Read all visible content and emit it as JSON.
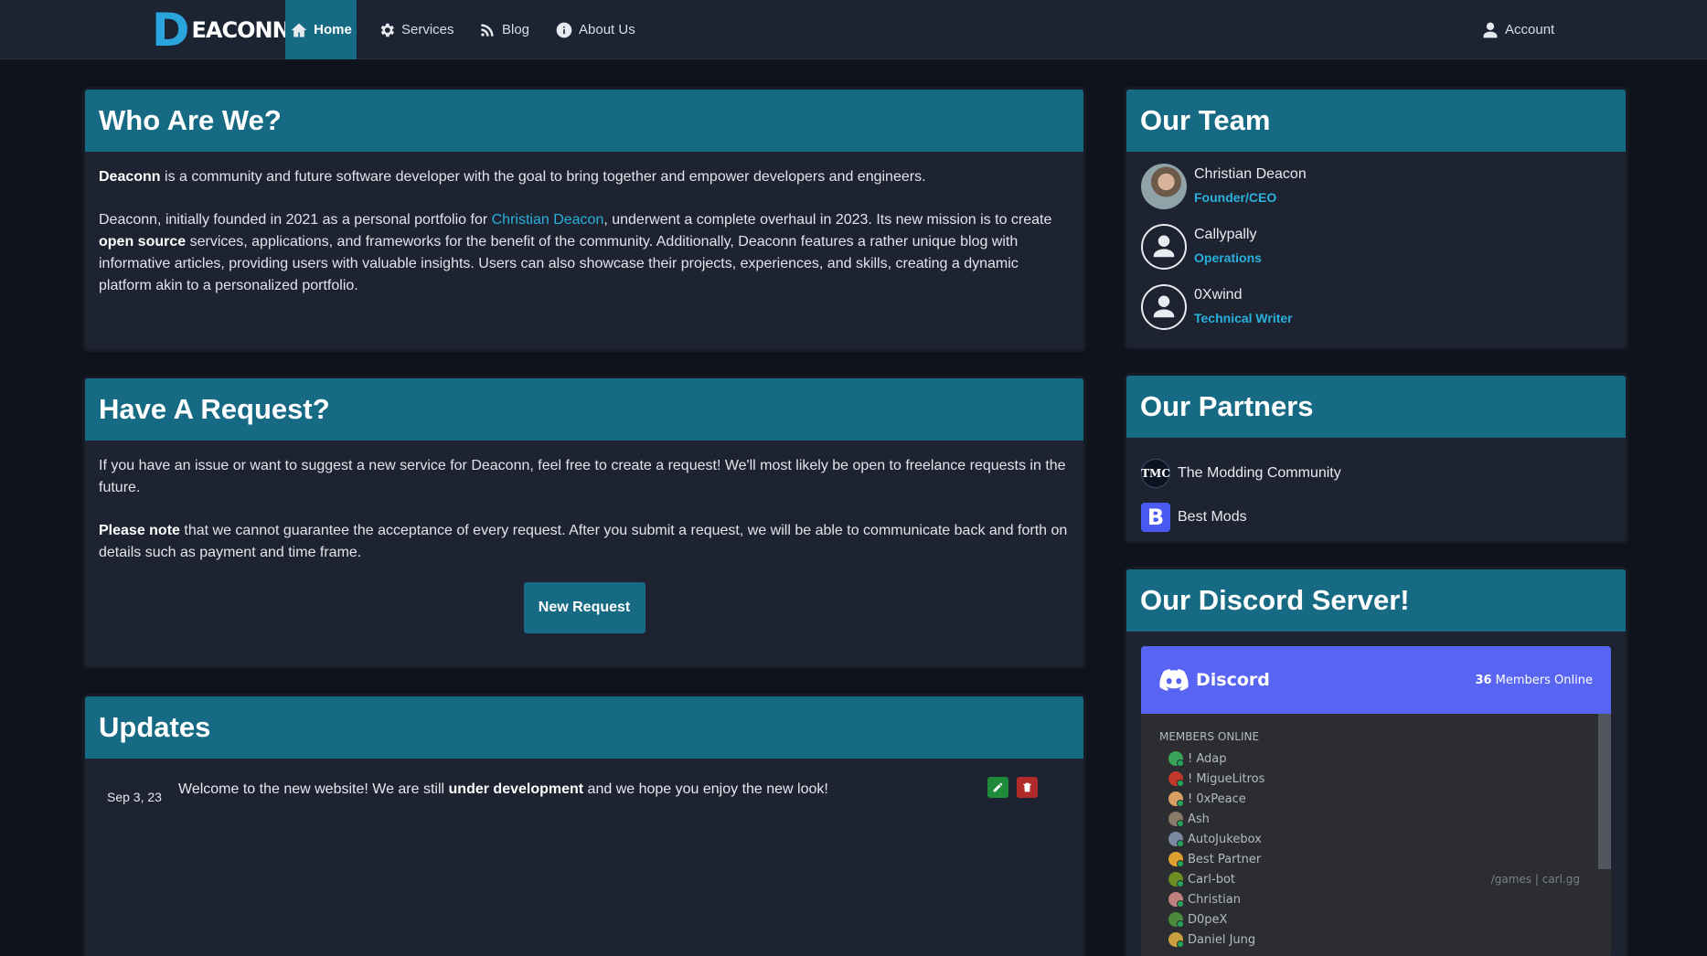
{
  "brand": {
    "letter": "D",
    "rest": "EACONN"
  },
  "nav": {
    "home": "Home",
    "services": "Services",
    "blog": "Blog",
    "about": "About Us",
    "account": "Account"
  },
  "who": {
    "title": "Who Are We?",
    "p1_bold": "Deaconn",
    "p1_rest": " is a community and future software developer with the goal to bring together and empower developers and engineers.",
    "p2_a": "Deaconn, initially founded in 2021 as a personal portfolio for ",
    "p2_link": "Christian Deacon",
    "p2_b": ", underwent a complete overhaul in 2023. Its new mission is to create ",
    "p2_bold": "open source",
    "p2_c": " services, applications, and frameworks for the benefit of the community. Additionally, Deaconn features a rather unique blog with informative articles, providing users with valuable insights. Users can also showcase their projects, experiences, and skills, creating a dynamic platform akin to a personalized portfolio."
  },
  "request": {
    "title": "Have A Request?",
    "p1": "If you have an issue or want to suggest a new service for Deaconn, feel free to create a request! We'll most likely be open to freelance requests in the future.",
    "p2_bold": "Please note",
    "p2_rest": " that we cannot guarantee the acceptance of every request. After you submit a request, we will be able to communicate back and forth on details such as payment and time frame.",
    "button": "New Request"
  },
  "updates": {
    "title": "Updates",
    "items": [
      {
        "date": "Sep 3, 23",
        "text_a": "Welcome to the new website! We are still ",
        "text_bold": "under development",
        "text_b": " and we hope you enjoy the new look!"
      }
    ]
  },
  "team": {
    "title": "Our Team",
    "members": [
      {
        "name": "Christian Deacon",
        "role": "Founder/CEO"
      },
      {
        "name": "Callypally",
        "role": "Operations"
      },
      {
        "name": "0Xwind",
        "role": "Technical Writer"
      }
    ]
  },
  "partners": {
    "title": "Our Partners",
    "items": [
      {
        "name": "The Modding Community",
        "logo_text": "TMC"
      },
      {
        "name": "Best Mods",
        "logo_text": "B"
      }
    ]
  },
  "discord": {
    "title": "Our Discord Server!",
    "brand": "Discord",
    "online_count": "36",
    "online_label": " Members Online",
    "section": "MEMBERS ONLINE",
    "members": [
      {
        "name": "! Adap",
        "color": "#3aa35a",
        "game": ""
      },
      {
        "name": "! MigueLitros",
        "color": "#c0392b",
        "game": ""
      },
      {
        "name": "! 0xPeace",
        "color": "#d9a066",
        "game": ""
      },
      {
        "name": "Ash",
        "color": "#8a7a6a",
        "game": ""
      },
      {
        "name": "AutoJukebox",
        "color": "#7a8aa0",
        "game": ""
      },
      {
        "name": "Best Partner",
        "color": "#e0a030",
        "game": ""
      },
      {
        "name": "Carl-bot",
        "color": "#6b8e23",
        "game": "/games | carl.gg"
      },
      {
        "name": "Christian",
        "color": "#c08080",
        "game": ""
      },
      {
        "name": "D0peX",
        "color": "#4a8a3a",
        "game": ""
      },
      {
        "name": "Daniel Jung",
        "color": "#c9a040",
        "game": ""
      }
    ]
  },
  "colors": {
    "accent": "#176a84",
    "link": "#2ab0dc",
    "background": "#0f141c",
    "card": "#1d2330",
    "discord": "#5865f2"
  }
}
